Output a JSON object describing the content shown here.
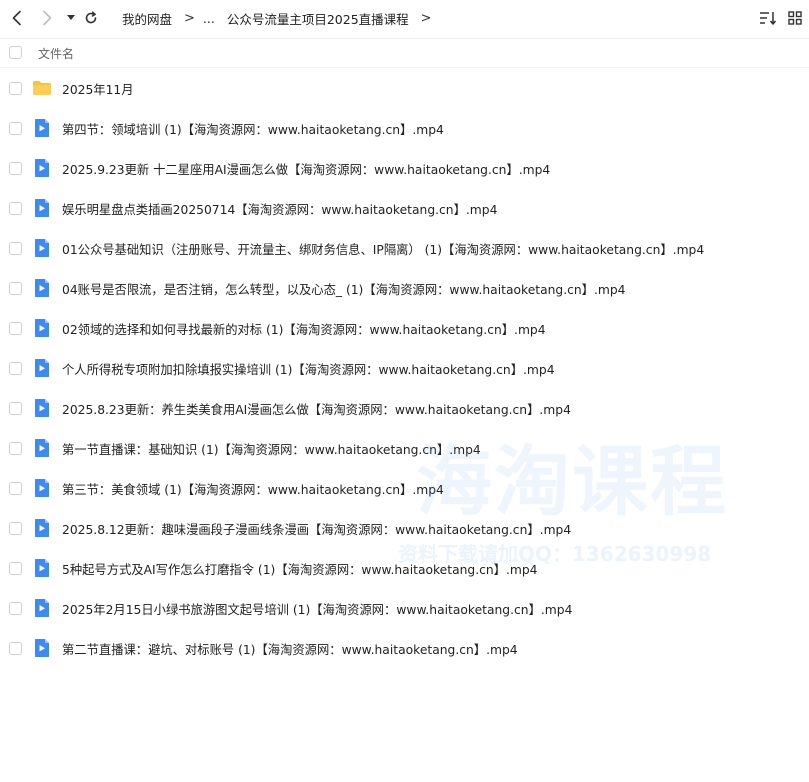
{
  "toolbar": {
    "back_icon": "chevron-left-icon",
    "forward_icon": "chevron-right-icon",
    "dropdown_icon": "caret-down-icon",
    "refresh_icon": "refresh-icon",
    "sort_icon": "sort-icon",
    "grid_icon": "grid-view-icon"
  },
  "breadcrumb": {
    "root": "我的网盘",
    "separator": ">",
    "ellipsis": "...",
    "current": "公众号流量主项目2025直播课程"
  },
  "header": {
    "name_label": "文件名"
  },
  "files": [
    {
      "name": "2025年11月",
      "type": "folder"
    },
    {
      "name": "第四节：领域培训 (1)【海淘资源网：www.haitaoketang.cn】.mp4",
      "type": "video"
    },
    {
      "name": "2025.9.23更新 十二星座用AI漫画怎么做【海淘资源网：www.haitaoketang.cn】.mp4",
      "type": "video"
    },
    {
      "name": "娱乐明星盘点类插画20250714【海淘资源网：www.haitaoketang.cn】.mp4",
      "type": "video"
    },
    {
      "name": "01公众号基础知识（注册账号、开流量主、绑财务信息、IP隔离） (1)【海淘资源网：www.haitaoketang.cn】.mp4",
      "type": "video"
    },
    {
      "name": "04账号是否限流，是否注销，怎么转型，以及心态_ (1)【海淘资源网：www.haitaoketang.cn】.mp4",
      "type": "video"
    },
    {
      "name": "02领域的选择和如何寻找最新的对标 (1)【海淘资源网：www.haitaoketang.cn】.mp4",
      "type": "video"
    },
    {
      "name": "个人所得税专项附加扣除填报实操培训 (1)【海淘资源网：www.haitaoketang.cn】.mp4",
      "type": "video"
    },
    {
      "name": "2025.8.23更新：养生类美食用AI漫画怎么做【海淘资源网：www.haitaoketang.cn】.mp4",
      "type": "video"
    },
    {
      "name": "第一节直播课：基础知识 (1)【海淘资源网：www.haitaoketang.cn】.mp4",
      "type": "video"
    },
    {
      "name": "第三节：美食领域 (1)【海淘资源网：www.haitaoketang.cn】.mp4",
      "type": "video"
    },
    {
      "name": "2025.8.12更新：趣味漫画段子漫画线条漫画【海淘资源网：www.haitaoketang.cn】.mp4",
      "type": "video"
    },
    {
      "name": "5种起号方式及AI写作怎么打磨指令 (1)【海淘资源网：www.haitaoketang.cn】.mp4",
      "type": "video"
    },
    {
      "name": "2025年2月15日小绿书旅游图文起号培训 (1)【海淘资源网：www.haitaoketang.cn】.mp4",
      "type": "video"
    },
    {
      "name": "第二节直播课：避坑、对标账号 (1)【海淘资源网：www.haitaoketang.cn】.mp4",
      "type": "video"
    }
  ],
  "watermark": {
    "title": "海淘课程",
    "subtitle": "资料下载请加QQ：1362630998"
  },
  "colors": {
    "folder": "#F9C23C",
    "video": "#3D8BF2",
    "watermark": "#5D9CE6"
  }
}
